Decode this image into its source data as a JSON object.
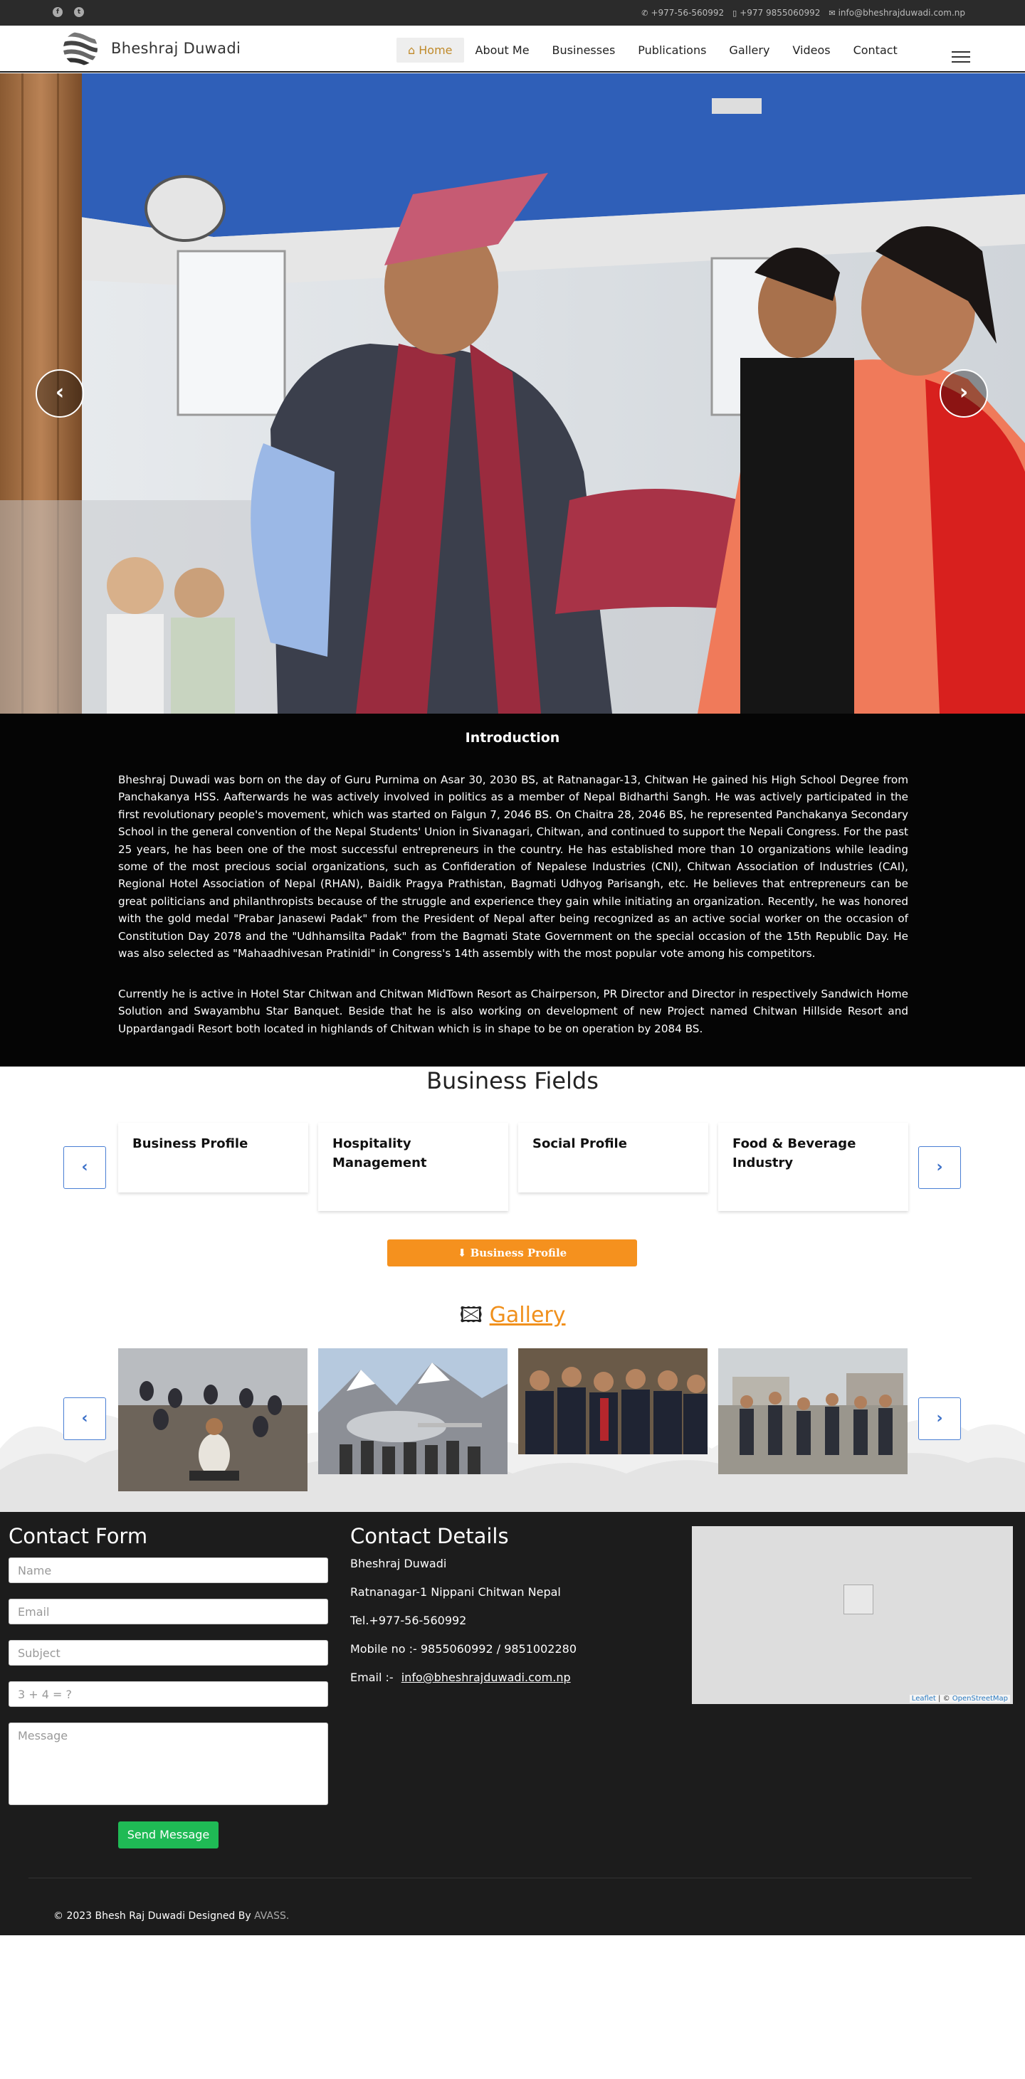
{
  "topbar": {
    "social": [
      {
        "icon": "facebook-icon",
        "glyph": "f"
      },
      {
        "icon": "twitter-icon",
        "glyph": "t"
      }
    ],
    "phone": "+977-56-560992",
    "mobile": "+977 9855060992",
    "email": "info@bheshrajduwadi.com.np"
  },
  "brand": {
    "name": "Bheshraj Duwadi"
  },
  "menu": [
    {
      "label": "Home",
      "icon": "home-icon",
      "active": true
    },
    {
      "label": "About Me"
    },
    {
      "label": "Businesses"
    },
    {
      "label": "Publications"
    },
    {
      "label": "Gallery"
    },
    {
      "label": "Videos"
    },
    {
      "label": "Contact"
    }
  ],
  "intro": {
    "title": "Introduction",
    "para1": "Bheshraj Duwadi was born on the day of Guru Purnima on Asar 30, 2030 BS, at Ratnanagar-13, Chitwan He gained his High School Degree from Panchakanya HSS. Aafterwards he was actively involved in politics as a member of Nepal Bidharthi Sangh. He was actively participated in the first revolutionary people's movement, which was started on Falgun 7, 2046 BS. On Chaitra 28, 2046 BS, he represented Panchakanya Secondary School in the general convention of the Nepal Students' Union in Sivanagari, Chitwan, and continued to support the Nepali Congress. For the past 25 years, he has been one of the most successful entrepreneurs in the country. He has established more than 10 organizations while leading some of the most precious social organizations, such as Confideration of Nepalese Industries (CNI), Chitwan Association of Industries (CAI), Regional Hotel Association of Nepal (RHAN), Baidik Pragya Prathistan, Bagmati Udhyog Parisangh, etc. He believes that entrepreneurs can be great politicians and philanthropists because of the struggle and experience they gain while initiating an organization. Recently, he was honored with the gold medal \"Prabar Janasewi Padak\" from the President of Nepal after being recognized as an active social worker on the occasion of Constitution Day 2078 and the \"Udhhamsilta Padak\" from the Bagmati State Government on the special occasion of the 15th Republic Day. He was also selected as \"Mahaadhivesan Pratinidi\" in Congress's 14th assembly with the most popular vote among his competitors.",
    "para2": "Currently he is active in Hotel Star Chitwan and Chitwan MidTown Resort as Chairperson, PR Director and Director in respectively Sandwich Home Solution and Swayambhu Star Banquet. Beside that he is also working on development of new Project named Chitwan Hillside Resort and Uppardangadi Resort both located in highlands of Chitwan which is in shape to be on operation by 2084 BS."
  },
  "business": {
    "title": "Business Fields",
    "cards": [
      "Business Profile",
      "Hospitality Management",
      "Social Profile",
      "Food & Beverage Industry"
    ],
    "prev_icon": "chevron-left-icon",
    "next_icon": "chevron-right-icon",
    "download_label": "Business Profile",
    "download_icon": "download-icon"
  },
  "gallery": {
    "title": "Gallery",
    "icon": "images-icon",
    "prev_icon": "chevron-left-icon",
    "next_icon": "chevron-right-icon"
  },
  "contact_form": {
    "title": "Contact Form",
    "name_placeholder": "Name",
    "email_placeholder": "Email",
    "subject_placeholder": "Subject",
    "captcha_placeholder": "3 + 4 = ?",
    "message_placeholder": "Message",
    "send_label": "Send Message"
  },
  "contact_details": {
    "title": "Contact Details",
    "name": "Bheshraj Duwadi",
    "address": "Ratnanagar-1 Nippani Chitwan Nepal",
    "tel": "Tel.+977-56-560992",
    "mobile": "Mobile no :- 9855060992 / 9851002280",
    "email_label": "Email :-",
    "email": "info@bheshrajduwadi.com.np"
  },
  "map": {
    "attribution_leaflet": "Leaflet",
    "attribution_sep": "| ©",
    "attribution_osm": "OpenStreetMap"
  },
  "footer": {
    "text": "© 2023 Bhesh Raj Duwadi Designed By",
    "designer": "AVASS."
  },
  "colors": {
    "accent": "#f5911e",
    "nav_active": "#c08a2a",
    "send": "#1fba55",
    "dark": "#1c1c1c"
  }
}
